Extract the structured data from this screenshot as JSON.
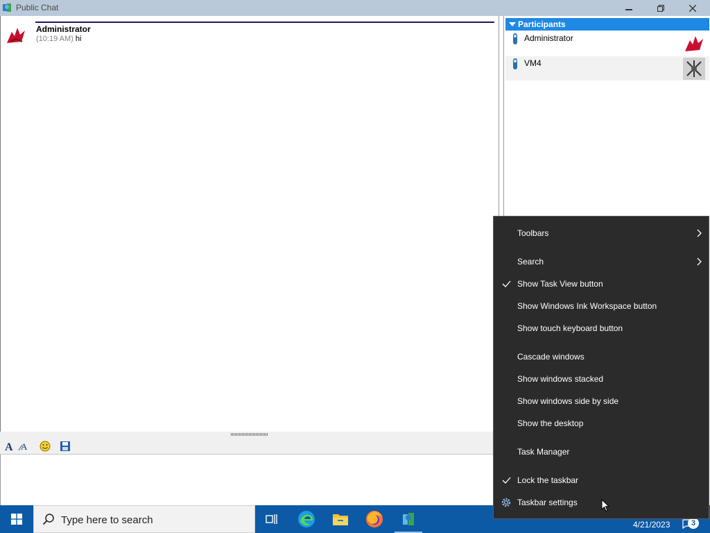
{
  "window": {
    "title": "Public Chat"
  },
  "chat": {
    "messages": [
      {
        "sender": "Administrator",
        "time": "(10:19 AM)",
        "text": "hi"
      }
    ]
  },
  "participants": {
    "header": "Participants",
    "items": [
      {
        "name": "Administrator"
      },
      {
        "name": "VM4"
      }
    ]
  },
  "taskbar": {
    "search_placeholder": "Type here to search",
    "date": "4/21/2023",
    "notification_count": "3",
    "accent": "#0c5aa6"
  },
  "context_menu": {
    "items": [
      {
        "label": "Toolbars",
        "checked": false,
        "submenu": true
      },
      {
        "label": "Search",
        "checked": false,
        "submenu": true
      },
      {
        "label": "Show Task View button",
        "checked": true,
        "submenu": false
      },
      {
        "label": "Show Windows Ink Workspace button",
        "checked": false,
        "submenu": false
      },
      {
        "label": "Show touch keyboard button",
        "checked": false,
        "submenu": false
      },
      {
        "label": "Cascade windows",
        "checked": false,
        "submenu": false
      },
      {
        "label": "Show windows stacked",
        "checked": false,
        "submenu": false
      },
      {
        "label": "Show windows side by side",
        "checked": false,
        "submenu": false
      },
      {
        "label": "Show the desktop",
        "checked": false,
        "submenu": false
      },
      {
        "label": "Task Manager",
        "checked": false,
        "submenu": false
      },
      {
        "label": "Lock the taskbar",
        "checked": true,
        "submenu": false
      },
      {
        "label": "Taskbar settings",
        "checked": false,
        "submenu": false,
        "icon": "gear-icon"
      }
    ]
  }
}
